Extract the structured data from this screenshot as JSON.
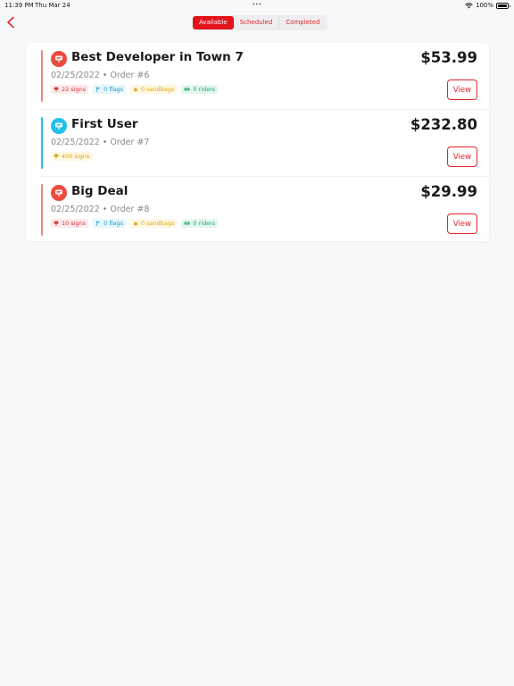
{
  "status_bar": {
    "time": "11:39 PM",
    "date": "Thu Mar 24",
    "battery": "100%",
    "icons": [
      "wifi-icon",
      "battery-icon"
    ]
  },
  "nav": {
    "back_icon": "chevron-left-icon",
    "tabs": [
      {
        "label": "Available",
        "active": true
      },
      {
        "label": "Scheduled",
        "active": false
      },
      {
        "label": "Completed",
        "active": false
      }
    ]
  },
  "colors": {
    "accent": "#e3141c",
    "red_bar": "#f0857f",
    "blue_bar": "#24c0e0",
    "red_avatar": "#ee4b3f",
    "blue_avatar": "#22bfe6"
  },
  "orders": [
    {
      "title": "Best Developer in Town 7",
      "meta": "02/25/2022 • Order #6",
      "price": "$53.99",
      "view_label": "View",
      "tags": {
        "signs": "22 signs",
        "flags": "0 flags",
        "sandbags": "0 sandbags",
        "riders": "0 riders"
      }
    },
    {
      "title": "First User",
      "meta": "02/25/2022 • Order #7",
      "price": "$232.80",
      "view_label": "View",
      "tags": {
        "signs": "400 signs"
      }
    },
    {
      "title": "Big Deal",
      "meta": "02/25/2022 • Order #8",
      "price": "$29.99",
      "view_label": "View",
      "tags": {
        "signs": "10 signs",
        "flags": "0 flags",
        "sandbags": "0 sandbags",
        "riders": "0 riders"
      }
    }
  ]
}
